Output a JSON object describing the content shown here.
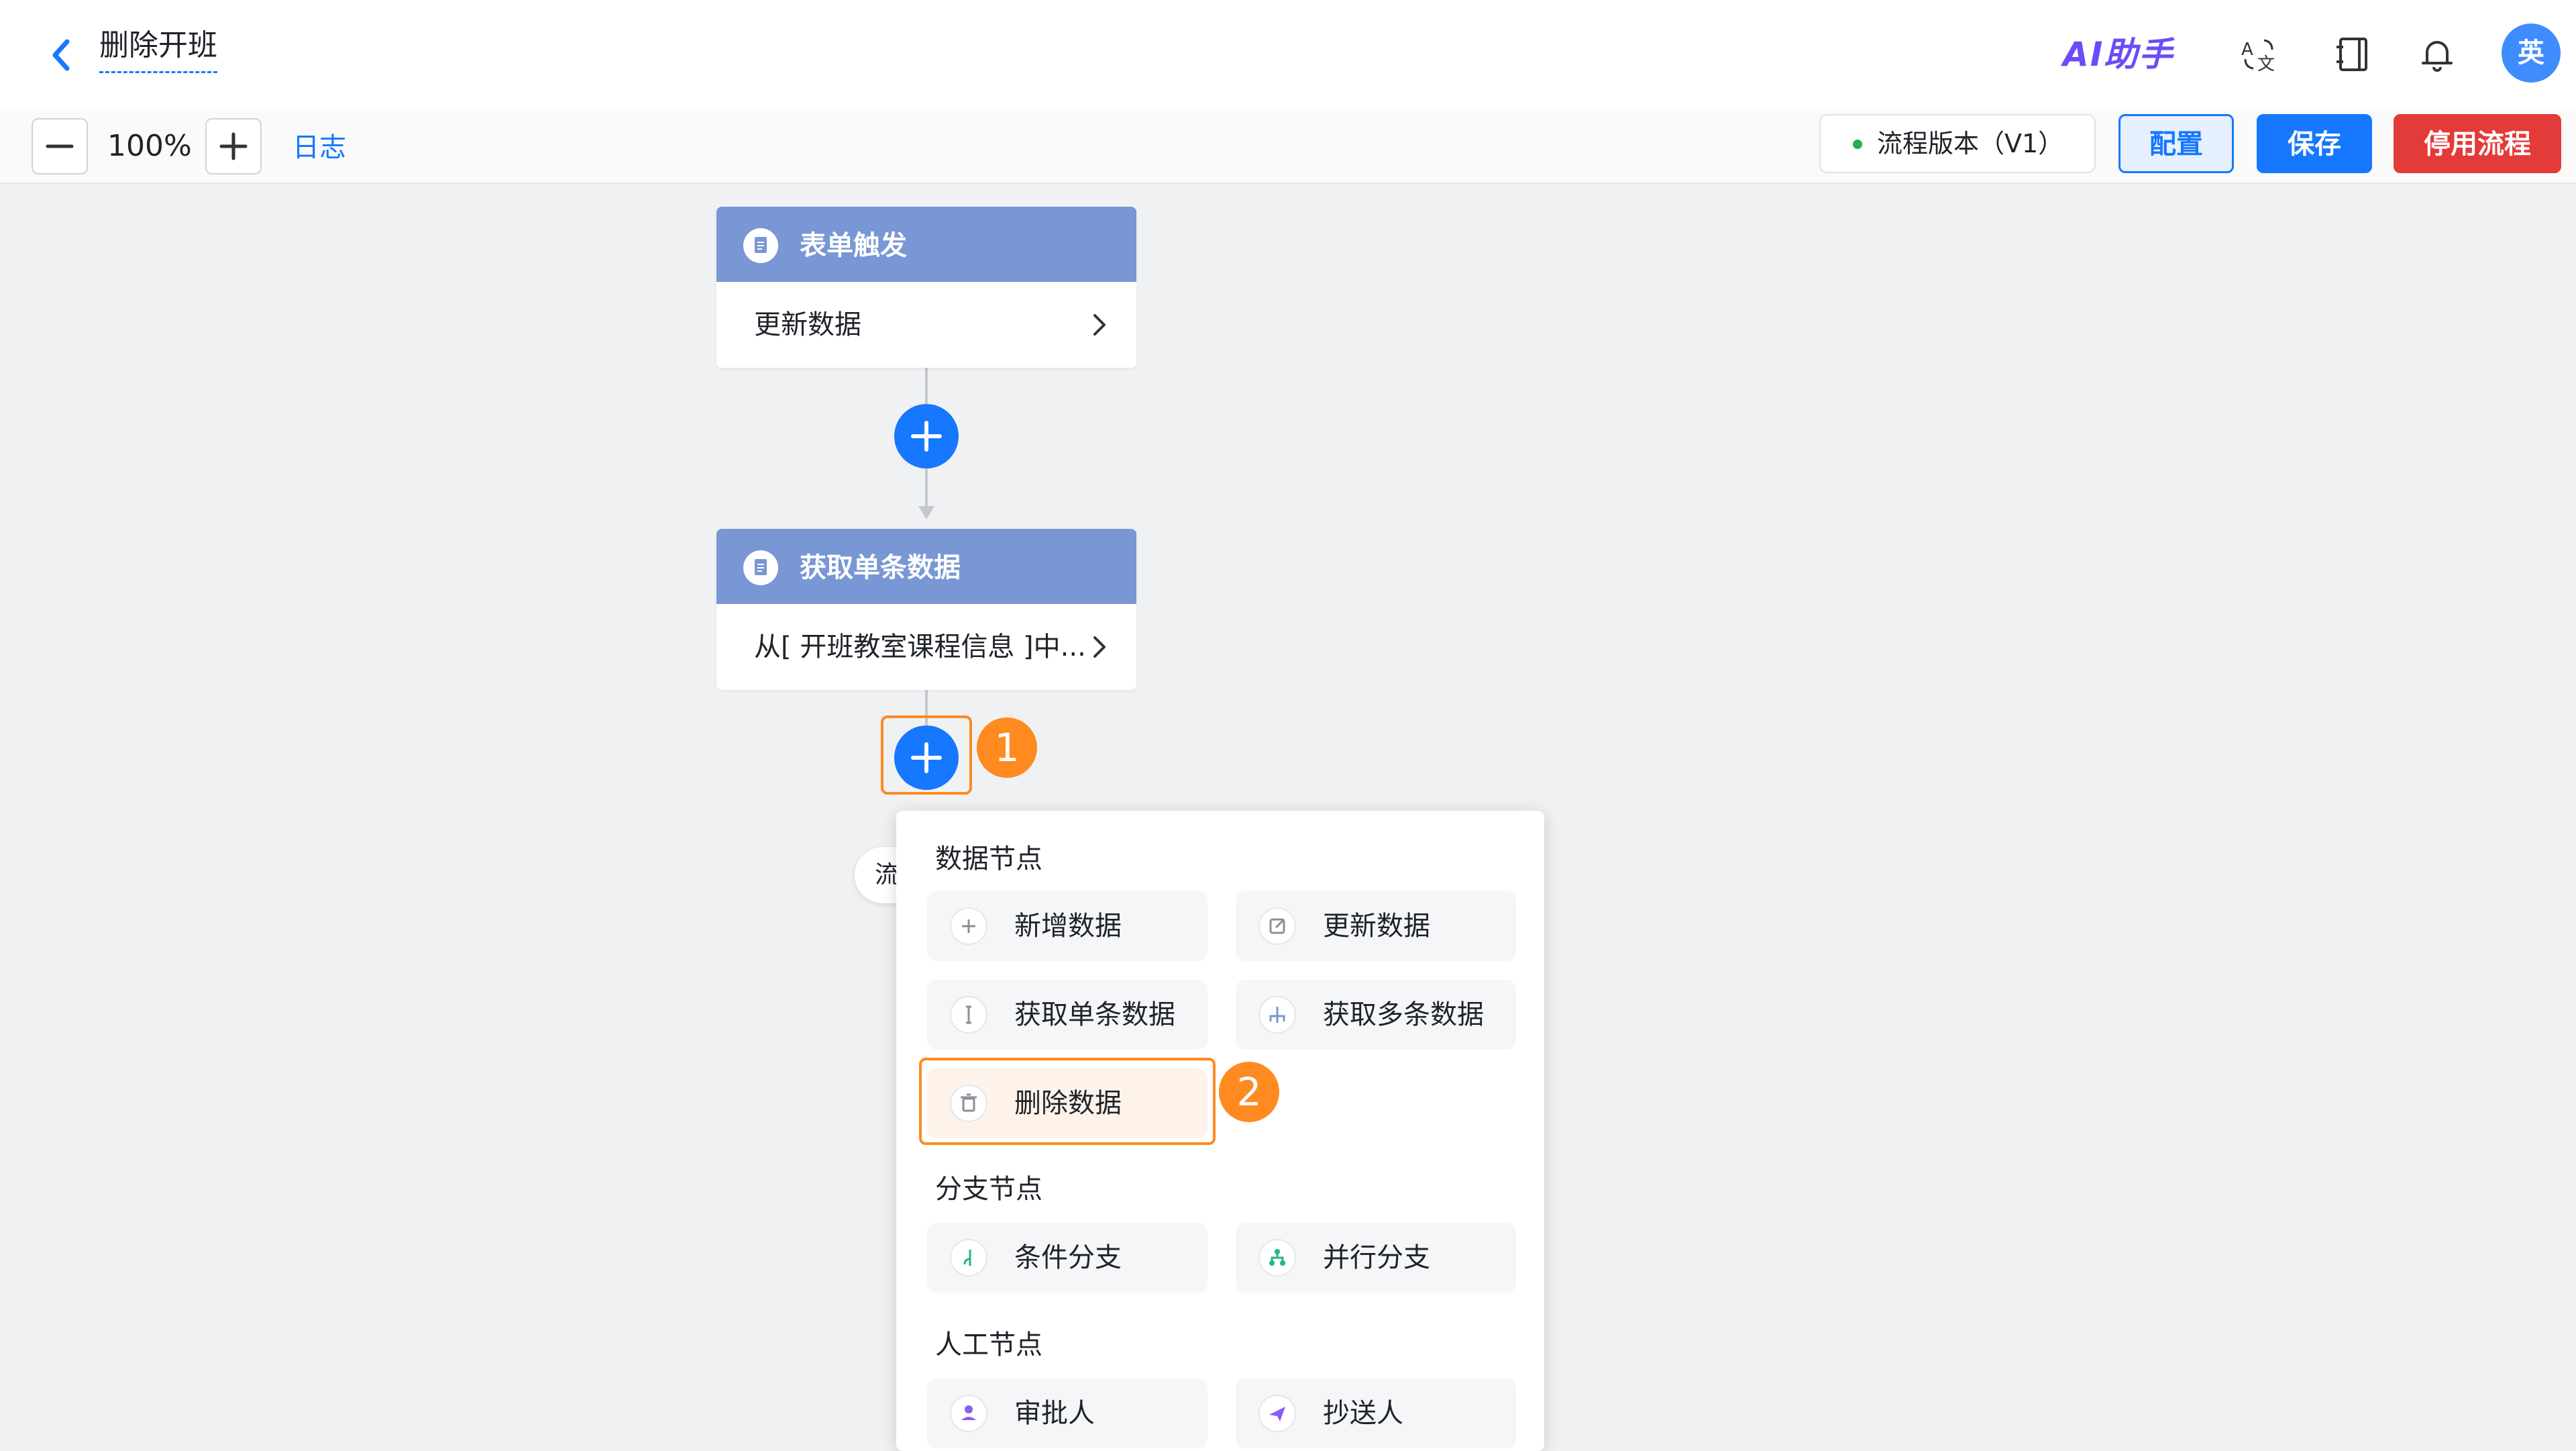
{
  "header": {
    "title": "删除开班",
    "ai_assistant": "AI助手",
    "avatar_text": "英"
  },
  "toolbar": {
    "zoom_level": "100%",
    "log_label": "日志",
    "version_label": "流程版本（V1）",
    "config_label": "配置",
    "save_label": "保存",
    "stop_label": "停用流程"
  },
  "flow": {
    "nodes": [
      {
        "title": "表单触发",
        "description": "更新数据"
      },
      {
        "title": "获取单条数据",
        "description": "从[ 开班教室课程信息 ]中..."
      }
    ],
    "hidden_pill_text": "流"
  },
  "annotations": {
    "badge_1": "1",
    "badge_2": "2"
  },
  "node_menu": {
    "sections": [
      {
        "title": "数据节点",
        "items": [
          {
            "label": "新增数据",
            "icon": "plus-icon"
          },
          {
            "label": "更新数据",
            "icon": "edit-icon"
          },
          {
            "label": "获取单条数据",
            "icon": "single-data-icon"
          },
          {
            "label": "获取多条数据",
            "icon": "multi-data-icon"
          },
          {
            "label": "删除数据",
            "icon": "trash-icon"
          }
        ]
      },
      {
        "title": "分支节点",
        "items": [
          {
            "label": "条件分支",
            "icon": "condition-branch-icon"
          },
          {
            "label": "并行分支",
            "icon": "parallel-branch-icon"
          }
        ]
      },
      {
        "title": "人工节点",
        "items": [
          {
            "label": "审批人",
            "icon": "approver-icon"
          },
          {
            "label": "抄送人",
            "icon": "cc-icon"
          }
        ]
      }
    ]
  },
  "colors": {
    "primary": "#1677ff",
    "danger": "#e33a3a",
    "node_header": "#7897d4",
    "annotation": "#ff8a1f",
    "status_dot": "#22b14c"
  }
}
